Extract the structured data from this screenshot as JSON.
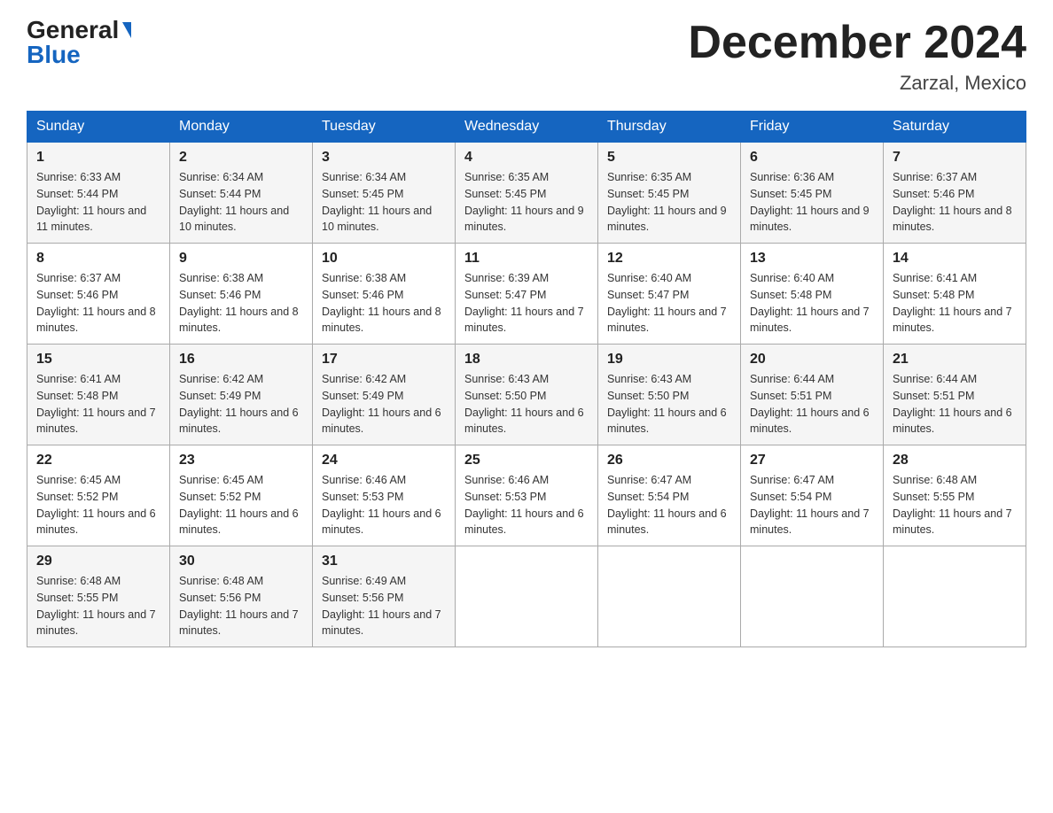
{
  "logo": {
    "general": "General",
    "blue": "Blue"
  },
  "title": "December 2024",
  "location": "Zarzal, Mexico",
  "days_of_week": [
    "Sunday",
    "Monday",
    "Tuesday",
    "Wednesday",
    "Thursday",
    "Friday",
    "Saturday"
  ],
  "weeks": [
    [
      {
        "day": "1",
        "sunrise": "6:33 AM",
        "sunset": "5:44 PM",
        "daylight": "11 hours and 11 minutes."
      },
      {
        "day": "2",
        "sunrise": "6:34 AM",
        "sunset": "5:44 PM",
        "daylight": "11 hours and 10 minutes."
      },
      {
        "day": "3",
        "sunrise": "6:34 AM",
        "sunset": "5:45 PM",
        "daylight": "11 hours and 10 minutes."
      },
      {
        "day": "4",
        "sunrise": "6:35 AM",
        "sunset": "5:45 PM",
        "daylight": "11 hours and 9 minutes."
      },
      {
        "day": "5",
        "sunrise": "6:35 AM",
        "sunset": "5:45 PM",
        "daylight": "11 hours and 9 minutes."
      },
      {
        "day": "6",
        "sunrise": "6:36 AM",
        "sunset": "5:45 PM",
        "daylight": "11 hours and 9 minutes."
      },
      {
        "day": "7",
        "sunrise": "6:37 AM",
        "sunset": "5:46 PM",
        "daylight": "11 hours and 8 minutes."
      }
    ],
    [
      {
        "day": "8",
        "sunrise": "6:37 AM",
        "sunset": "5:46 PM",
        "daylight": "11 hours and 8 minutes."
      },
      {
        "day": "9",
        "sunrise": "6:38 AM",
        "sunset": "5:46 PM",
        "daylight": "11 hours and 8 minutes."
      },
      {
        "day": "10",
        "sunrise": "6:38 AM",
        "sunset": "5:46 PM",
        "daylight": "11 hours and 8 minutes."
      },
      {
        "day": "11",
        "sunrise": "6:39 AM",
        "sunset": "5:47 PM",
        "daylight": "11 hours and 7 minutes."
      },
      {
        "day": "12",
        "sunrise": "6:40 AM",
        "sunset": "5:47 PM",
        "daylight": "11 hours and 7 minutes."
      },
      {
        "day": "13",
        "sunrise": "6:40 AM",
        "sunset": "5:48 PM",
        "daylight": "11 hours and 7 minutes."
      },
      {
        "day": "14",
        "sunrise": "6:41 AM",
        "sunset": "5:48 PM",
        "daylight": "11 hours and 7 minutes."
      }
    ],
    [
      {
        "day": "15",
        "sunrise": "6:41 AM",
        "sunset": "5:48 PM",
        "daylight": "11 hours and 7 minutes."
      },
      {
        "day": "16",
        "sunrise": "6:42 AM",
        "sunset": "5:49 PM",
        "daylight": "11 hours and 6 minutes."
      },
      {
        "day": "17",
        "sunrise": "6:42 AM",
        "sunset": "5:49 PM",
        "daylight": "11 hours and 6 minutes."
      },
      {
        "day": "18",
        "sunrise": "6:43 AM",
        "sunset": "5:50 PM",
        "daylight": "11 hours and 6 minutes."
      },
      {
        "day": "19",
        "sunrise": "6:43 AM",
        "sunset": "5:50 PM",
        "daylight": "11 hours and 6 minutes."
      },
      {
        "day": "20",
        "sunrise": "6:44 AM",
        "sunset": "5:51 PM",
        "daylight": "11 hours and 6 minutes."
      },
      {
        "day": "21",
        "sunrise": "6:44 AM",
        "sunset": "5:51 PM",
        "daylight": "11 hours and 6 minutes."
      }
    ],
    [
      {
        "day": "22",
        "sunrise": "6:45 AM",
        "sunset": "5:52 PM",
        "daylight": "11 hours and 6 minutes."
      },
      {
        "day": "23",
        "sunrise": "6:45 AM",
        "sunset": "5:52 PM",
        "daylight": "11 hours and 6 minutes."
      },
      {
        "day": "24",
        "sunrise": "6:46 AM",
        "sunset": "5:53 PM",
        "daylight": "11 hours and 6 minutes."
      },
      {
        "day": "25",
        "sunrise": "6:46 AM",
        "sunset": "5:53 PM",
        "daylight": "11 hours and 6 minutes."
      },
      {
        "day": "26",
        "sunrise": "6:47 AM",
        "sunset": "5:54 PM",
        "daylight": "11 hours and 6 minutes."
      },
      {
        "day": "27",
        "sunrise": "6:47 AM",
        "sunset": "5:54 PM",
        "daylight": "11 hours and 7 minutes."
      },
      {
        "day": "28",
        "sunrise": "6:48 AM",
        "sunset": "5:55 PM",
        "daylight": "11 hours and 7 minutes."
      }
    ],
    [
      {
        "day": "29",
        "sunrise": "6:48 AM",
        "sunset": "5:55 PM",
        "daylight": "11 hours and 7 minutes."
      },
      {
        "day": "30",
        "sunrise": "6:48 AM",
        "sunset": "5:56 PM",
        "daylight": "11 hours and 7 minutes."
      },
      {
        "day": "31",
        "sunrise": "6:49 AM",
        "sunset": "5:56 PM",
        "daylight": "11 hours and 7 minutes."
      },
      null,
      null,
      null,
      null
    ]
  ],
  "labels": {
    "sunrise": "Sunrise:",
    "sunset": "Sunset:",
    "daylight": "Daylight:"
  }
}
